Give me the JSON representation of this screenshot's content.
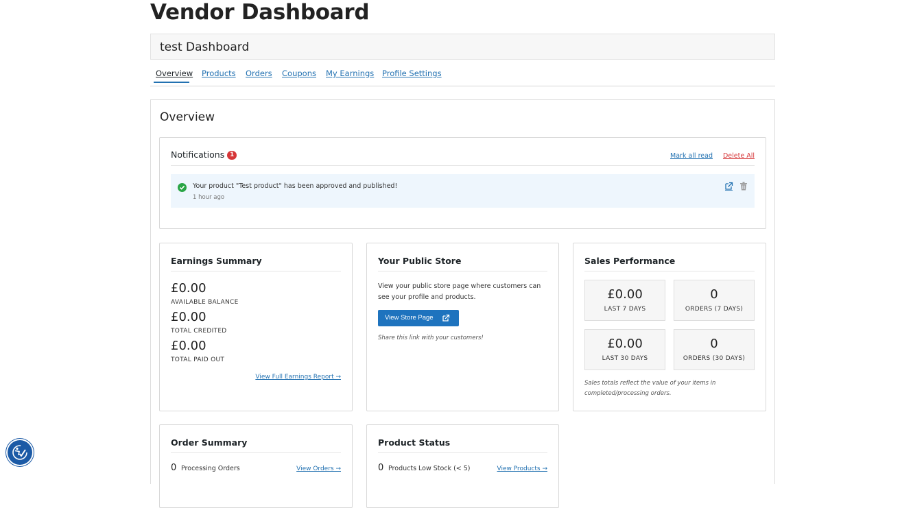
{
  "page": {
    "title": "Vendor Dashboard"
  },
  "dashboard": {
    "name": "test Dashboard"
  },
  "tabs": [
    {
      "label": "Overview",
      "active": true
    },
    {
      "label": "Products",
      "active": false
    },
    {
      "label": "Orders",
      "active": false
    },
    {
      "label": "Coupons",
      "active": false
    },
    {
      "label": "My Earnings",
      "active": false
    },
    {
      "label": "Profile Settings",
      "active": false
    }
  ],
  "overview": {
    "title": "Overview",
    "notifications": {
      "title": "Notifications",
      "count": "1",
      "mark_all_read": "Mark all read",
      "delete_all": "Delete All",
      "items": [
        {
          "message": "Your product \"Test product\" has been approved and published!",
          "time": "1 hour ago"
        }
      ]
    },
    "earnings": {
      "title": "Earnings Summary",
      "available_value": "£0.00",
      "available_label": "AVAILABLE BALANCE",
      "credited_value": "£0.00",
      "credited_label": "TOTAL CREDITED",
      "paid_value": "£0.00",
      "paid_label": "TOTAL PAID OUT",
      "report_link": "View Full Earnings Report →"
    },
    "store": {
      "title": "Your Public Store",
      "description": "View your public store page where customers can see your profile and products.",
      "button": "View Store Page",
      "share_note": "Share this link with your customers!"
    },
    "sales": {
      "title": "Sales Performance",
      "stats": [
        {
          "value": "£0.00",
          "label": "LAST 7 DAYS"
        },
        {
          "value": "0",
          "label": "ORDERS (7 DAYS)"
        },
        {
          "value": "£0.00",
          "label": "LAST 30 DAYS"
        },
        {
          "value": "0",
          "label": "ORDERS (30 DAYS)"
        }
      ],
      "note": "Sales totals reflect the value of your items in completed/processing orders."
    },
    "order_summary": {
      "title": "Order Summary",
      "processing_count": "0",
      "processing_label": "Processing Orders",
      "view_link": "View Orders →"
    },
    "product_status": {
      "title": "Product Status",
      "low_stock_count": "0",
      "low_stock_label": "Products Low Stock (< 5)",
      "view_link": "View Products →"
    }
  },
  "icons": {
    "notification_status": "check-circle-icon",
    "open_link": "external-link-icon",
    "delete": "trash-icon",
    "accessibility": "accessibility-icon"
  },
  "colors": {
    "link": "#2271b1",
    "danger": "#d63638",
    "success": "#2aa546",
    "button": "#1e73be",
    "notification_bg": "#eef6fd"
  }
}
